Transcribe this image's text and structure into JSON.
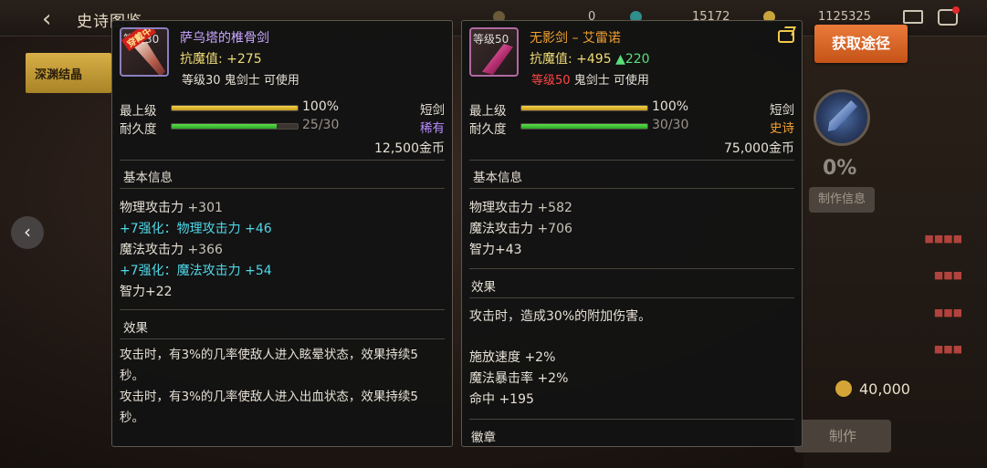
{
  "background": {
    "page_title": "史诗图鉴",
    "resources": [
      "0",
      "15172",
      "1125325"
    ],
    "side_tab": "深渊结晶",
    "progress": "0%",
    "make_info": "制作信息",
    "gold_amount": "40,000",
    "craft_label": "制作"
  },
  "obtain_button": "获取途径",
  "card1": {
    "icon_level": "等级30",
    "icon_tag": "穿戴中",
    "name": "萨乌塔的椎骨剑",
    "name_color": "#c9a6ff",
    "resist_label": "抗魔值:",
    "resist_value": "+275",
    "level_text": "等级30",
    "usage_text": "鬼剑士 可使用",
    "top_label": "最上级",
    "top_pct": "100%",
    "dura_label": "耐久度",
    "dura_value": "25/30",
    "dura_fraction": 0.833,
    "weapon_type": "短剑",
    "rarity": "稀有",
    "rarity_color": "#b68cff",
    "price": "12,500金币",
    "basic_title": "基本信息",
    "stats": [
      {
        "label": "物理攻击力",
        "value": "+301",
        "cyan": false
      },
      {
        "label": "+7强化：物理攻击力",
        "value": "+46",
        "cyan": true
      },
      {
        "label": "魔法攻击力",
        "value": "+366",
        "cyan": false
      },
      {
        "label": "+7强化：魔法攻击力",
        "value": "+54",
        "cyan": true
      },
      {
        "label": "智力",
        "value": "+22",
        "cyan": false
      }
    ],
    "effect_title": "效果",
    "effect_lines": [
      "攻击时，有3%的几率使敌人进入眩晕状态，效果持续5",
      "秒。",
      "攻击时，有3%的几率使敌人进入出血状态，效果持续5",
      "秒。"
    ]
  },
  "card2": {
    "icon_level": "等级50",
    "name": "无影剑 – 艾雷诺",
    "name_color": "#f0a030",
    "resist_label": "抗魔值:",
    "resist_value": "+495",
    "resist_up": "▲220",
    "level_text": "等级50",
    "usage_text": "鬼剑士 可使用",
    "top_label": "最上级",
    "top_pct": "100%",
    "dura_label": "耐久度",
    "dura_value": "30/30",
    "dura_fraction": 1.0,
    "weapon_type": "短剑",
    "rarity": "史诗",
    "rarity_color": "#f0a030",
    "price": "75,000金币",
    "basic_title": "基本信息",
    "stats": [
      {
        "label": "物理攻击力",
        "value": "+582"
      },
      {
        "label": "魔法攻击力",
        "value": "+706"
      },
      {
        "label": "智力",
        "value": "+43"
      }
    ],
    "effect_title": "效果",
    "effect_line": "攻击时，造成30%的附加伤害。",
    "extra_stats": [
      "施放速度 +2%",
      "魔法暴击率 +2%",
      "命中 +195"
    ],
    "emblem_title": "徽章"
  }
}
